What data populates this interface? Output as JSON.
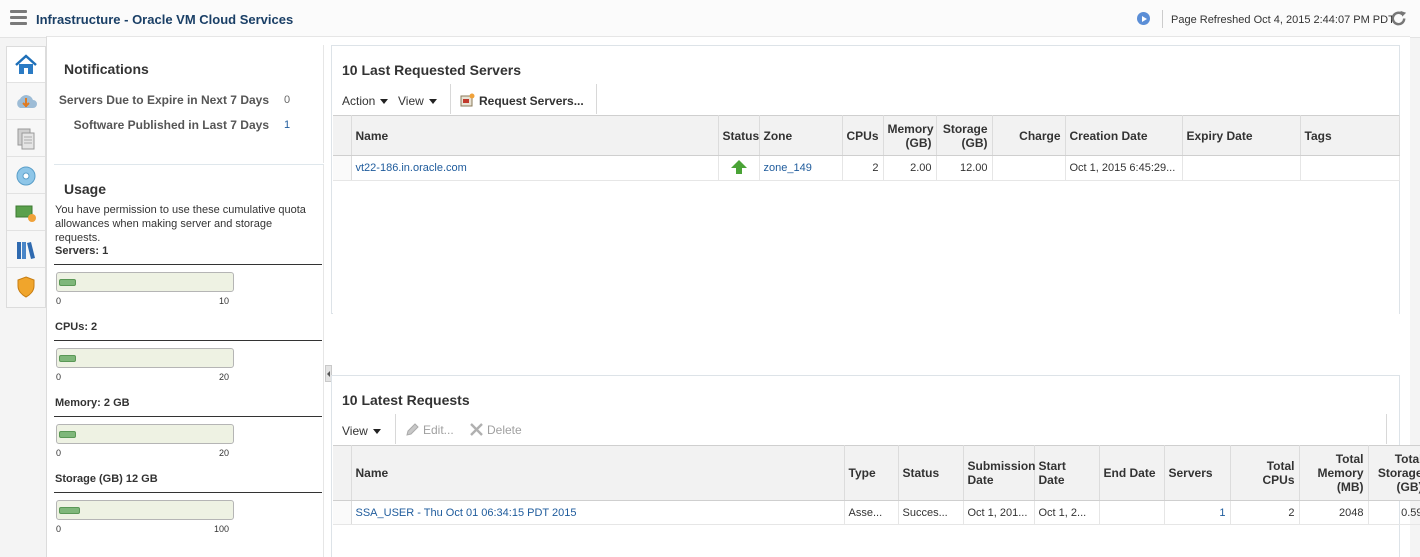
{
  "header": {
    "title": "Infrastructure - Oracle VM Cloud Services",
    "refresh_label": "Page Refreshed",
    "refresh_time": "Oct 4, 2015 2:44:07 PM PDT"
  },
  "rail": {
    "items": [
      "home-icon",
      "cloud-upload-icon",
      "documents-icon",
      "disc-icon",
      "server-tags-icon",
      "library-icon",
      "shield-icon"
    ]
  },
  "notifications": {
    "title": "Notifications",
    "rows": [
      {
        "label": "Servers Due to Expire in Next 7 Days",
        "count": "0"
      },
      {
        "label": "Software Published in Last 7 Days",
        "count": "1"
      }
    ]
  },
  "usage": {
    "title": "Usage",
    "description": "You have permission to use these cumulative quota allowances when making server and storage requests.",
    "meters": [
      {
        "label": "Servers: 1",
        "min": "0",
        "max": "10",
        "fraction": 0.1
      },
      {
        "label": "CPUs: 2",
        "min": "0",
        "max": "20",
        "fraction": 0.1
      },
      {
        "label": "Memory: 2 GB",
        "min": "0",
        "max": "20",
        "fraction": 0.1
      },
      {
        "label": "Storage (GB) 12 GB",
        "min": "0",
        "max": "100",
        "fraction": 0.12
      }
    ]
  },
  "servers_panel": {
    "title": "10 Last Requested Servers",
    "toolbar": {
      "action": "Action",
      "view": "View",
      "request": "Request Servers..."
    },
    "columns": {
      "name": "Name",
      "status": "Status",
      "zone": "Zone",
      "cpus": "CPUs",
      "memory": "Memory (GB)",
      "storage": "Storage (GB)",
      "charge": "Charge",
      "creation": "Creation Date",
      "expiry": "Expiry Date",
      "tags": "Tags"
    },
    "rows": [
      {
        "name": "vt22-186.in.oracle.com",
        "status": "up-arrow-icon",
        "zone": "zone_149",
        "cpus": "2",
        "memory": "2.00",
        "storage": "12.00",
        "charge": "",
        "creation": "Oct 1, 2015 6:45:29...",
        "expiry": "",
        "tags": ""
      }
    ]
  },
  "requests_panel": {
    "title": "10 Latest Requests",
    "toolbar": {
      "view": "View",
      "edit": "Edit...",
      "delete": "Delete"
    },
    "columns": {
      "name": "Name",
      "type": "Type",
      "status": "Status",
      "submission": "Submission Date",
      "start": "Start Date",
      "end": "End Date",
      "servers": "Servers",
      "cpus": "Total CPUs",
      "memory": "Total Memory (MB)",
      "storage": "Total Storage (GB)"
    },
    "rows": [
      {
        "name": "SSA_USER - Thu Oct 01 06:34:15 PDT 2015",
        "type": "Asse...",
        "status": "Succes...",
        "submission": "Oct 1, 201...",
        "start": "Oct 1, 2...",
        "end": "",
        "servers": "1",
        "cpus": "2",
        "memory": "2048",
        "storage": "0.59"
      }
    ]
  },
  "colors": {
    "brand": "#1a3f66",
    "link": "#1e5b9c",
    "status_up": "#4aa336",
    "usage_fill": "#7fb77a"
  }
}
